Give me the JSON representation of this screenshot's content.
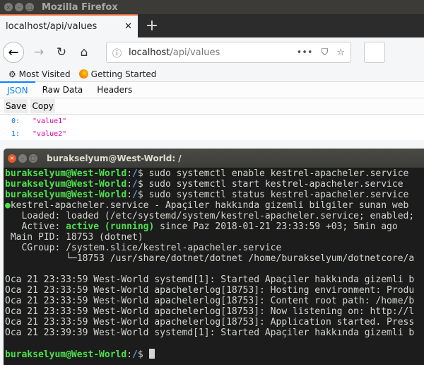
{
  "firefox": {
    "title": "Mozilla Firefox",
    "tab_title": "localhost/api/values",
    "url_host": "localhost",
    "url_path": "/api/values",
    "bookmarks": [
      "Most Visited",
      "Getting Started"
    ],
    "json_tabs": [
      "JSON",
      "Raw Data",
      "Headers"
    ],
    "toolbar": {
      "save": "Save",
      "copy": "Copy"
    },
    "rows": [
      {
        "key": "0:",
        "value": "\"value1\""
      },
      {
        "key": "1:",
        "value": "\"value2\""
      }
    ]
  },
  "terminal": {
    "title": "burakselyum@West-World: /",
    "prompt_user": "burakselyum@West-World",
    "prompt_path": "/",
    "commands": [
      "sudo systemctl enable kestrel-apacheler.service",
      "sudo systemctl start kestrel-apacheler.service",
      "sudo systemctl status kestrel-apacheler.service"
    ],
    "status_line": "kestrel-apacheler.service - Apaçiler hakkında gizemli bilgiler sunan web",
    "loaded": "   Loaded: loaded (/etc/systemd/system/kestrel-apacheler.service; enabled;",
    "active_label": "   Active: ",
    "active_state": "active (running)",
    "active_since": " since Paz 2018-01-21 23:33:59 +03; 5min ago",
    "main_pid": " Main PID: 18753 (dotnet)",
    "cgroup": "   CGroup: /system.slice/kestrel-apacheler.service",
    "cgroup_child": "           └─18753 /usr/share/dotnet/dotnet /home/burakselyum/dotnetcore/a",
    "logs": [
      "Oca 21 23:33:59 West-World systemd[1]: Started Apaçiler hakkında gizemli b",
      "Oca 21 23:33:59 West-World apachelerlog[18753]: Hosting environment: Produ",
      "Oca 21 23:33:59 West-World apachelerlog[18753]: Content root path: /home/b",
      "Oca 21 23:33:59 West-World apachelerlog[18753]: Now listening on: http://l",
      "Oca 21 23:33:59 West-World apachelerlog[18753]: Application started. Press",
      "Oca 21 23:39:39 West-World systemd[1]: Started Apaçiler hakkında gizemli b"
    ]
  }
}
